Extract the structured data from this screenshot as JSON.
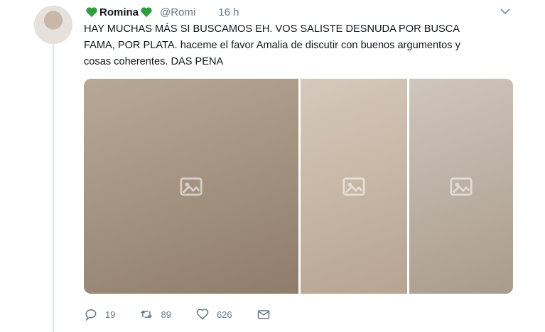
{
  "tweet": {
    "name": "Romina",
    "handle": "@Romi",
    "time": "16 h",
    "text": "HAY MUCHAS MÁS SI BUSCAMOS EH. VOS SALISTE DESNUDA POR BUSCA\nFAMA, POR PLATA. haceme el favor Amalia de discutir con buenos argumentos y\ncosas coherentes. DAS PENA",
    "media_count": 3
  },
  "actions": {
    "replies": "19",
    "retweets": "89",
    "likes": "626"
  },
  "icons": [
    "green-heart-icon",
    "chevron-down-icon",
    "reply-icon",
    "retweet-icon",
    "like-icon",
    "direct-message-icon"
  ],
  "colors": {
    "heart": "#2e9e3e",
    "muted": "#657786",
    "text": "#14171a",
    "thread_line": "#e1e8ed"
  }
}
